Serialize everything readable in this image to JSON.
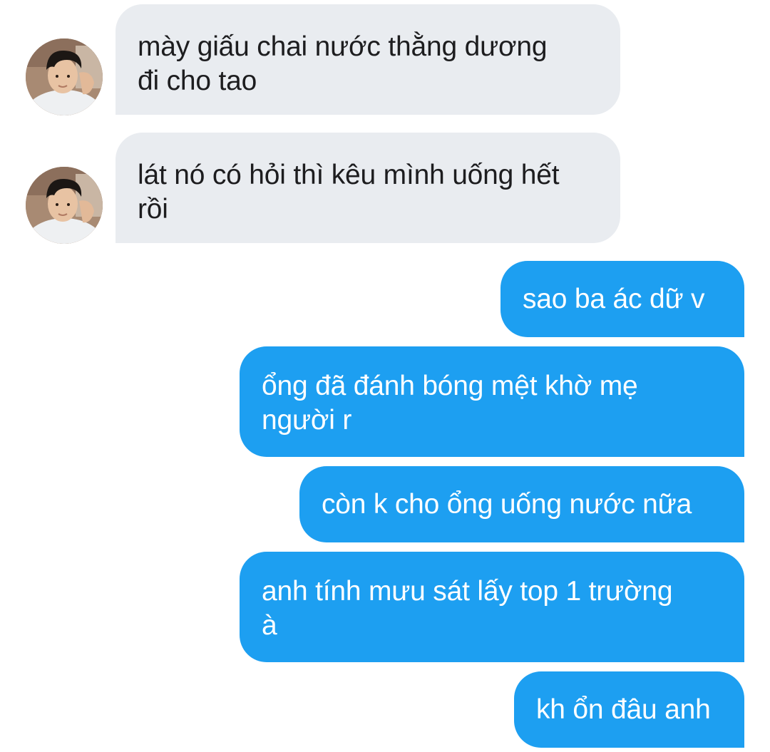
{
  "thread": {
    "messages": [
      {
        "direction": "incoming",
        "text": "mày giấu chai nước thằng dương\nđi cho tao",
        "avatar": "user-photo"
      },
      {
        "direction": "incoming",
        "text": "lát nó có hỏi thì kêu mình uống hết\nrồi",
        "avatar": "user-photo"
      },
      {
        "direction": "outgoing",
        "text": "sao ba ác dữ v"
      },
      {
        "direction": "outgoing",
        "text": "ổng đã đánh bóng mệt khờ mẹ\nngười r"
      },
      {
        "direction": "outgoing",
        "text": "còn k cho ổng uống nước nữa"
      },
      {
        "direction": "outgoing",
        "text": "anh tính mưu sát lấy top 1 trường\nà"
      },
      {
        "direction": "outgoing",
        "text": "kh ổn đâu anh"
      }
    ]
  },
  "colors": {
    "incoming_bubble": "#e9ecf0",
    "outgoing_bubble": "#1d9ff1",
    "incoming_text": "#1d1d1f",
    "outgoing_text": "#ffffff",
    "background": "#ffffff"
  }
}
